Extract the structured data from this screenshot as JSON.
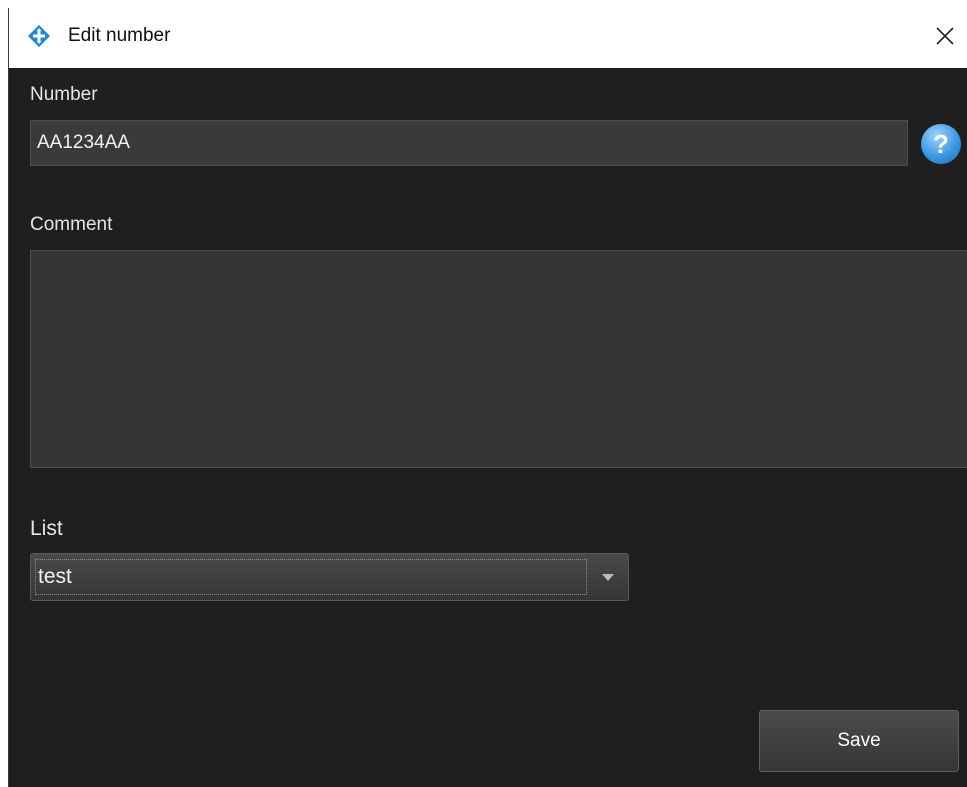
{
  "window": {
    "title": "Edit number",
    "app_icon": "app-logo-icon",
    "close_icon": "close-icon",
    "accent_color": "#1e88d6"
  },
  "form": {
    "number_label": "Number",
    "number_value": "AA1234AA",
    "help_icon": "help-icon",
    "help_glyph": "?",
    "comment_label": "Comment",
    "comment_value": "",
    "list_label": "List",
    "list_selected": "test"
  },
  "actions": {
    "save_label": "Save"
  }
}
